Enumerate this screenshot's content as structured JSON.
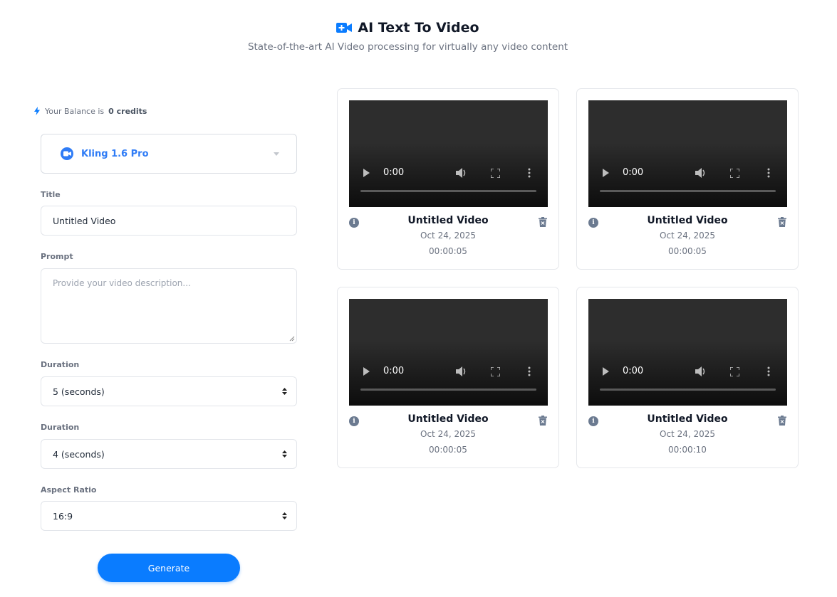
{
  "header": {
    "title": "AI Text To Video",
    "subtitle": "State-of-the-art AI Video processing for virtually any video content",
    "icon": "video-plus-icon",
    "accent_color": "#0a7cff"
  },
  "balance": {
    "prefix": "Your Balance is",
    "amount": "0 credits",
    "icon": "bolt-icon"
  },
  "model": {
    "selected": "Kling 1.6 Pro",
    "icon": "zoom-camera-icon"
  },
  "form": {
    "title_label": "Title",
    "title_value": "Untitled Video",
    "prompt_label": "Prompt",
    "prompt_placeholder": "Provide your video description...",
    "duration_label": "Duration",
    "duration_value": "5 (seconds)",
    "duration2_label": "Duration",
    "duration2_value": "4 (seconds)",
    "aspect_label": "Aspect Ratio",
    "aspect_value": "16:9",
    "generate_label": "Generate"
  },
  "videos": [
    {
      "title": "Untitled Video",
      "date": "Oct 24, 2025",
      "duration": "00:00:05",
      "time": "0:00"
    },
    {
      "title": "Untitled Video",
      "date": "Oct 24, 2025",
      "duration": "00:00:05",
      "time": "0:00"
    },
    {
      "title": "Untitled Video",
      "date": "Oct 24, 2025",
      "duration": "00:00:05",
      "time": "0:00"
    },
    {
      "title": "Untitled Video",
      "date": "Oct 24, 2025",
      "duration": "00:00:10",
      "time": "0:00"
    }
  ]
}
